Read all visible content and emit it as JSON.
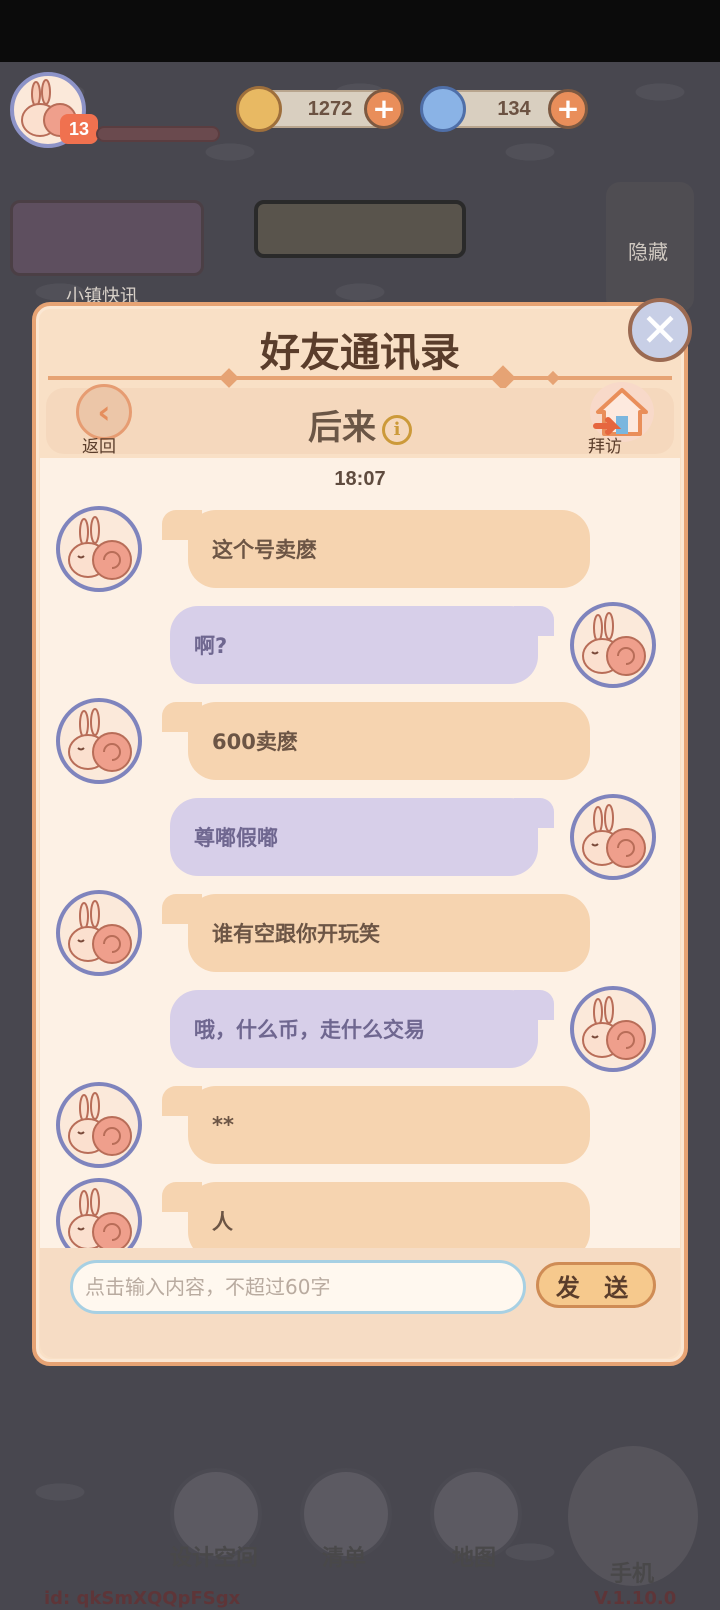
{
  "top_bar": {
    "level": "13",
    "coins": "1272",
    "gems": "134"
  },
  "background": {
    "news_label": "小镇快讯",
    "hide_label": "隐藏"
  },
  "dialog": {
    "title": "好友通讯录",
    "contact_name": "后来",
    "back_label": "返回",
    "visit_label": "拜访",
    "time": "18:07",
    "messages": [
      {
        "side": "left",
        "text": "这个号卖麽"
      },
      {
        "side": "right",
        "text": "啊?"
      },
      {
        "side": "left",
        "text": "600卖麽"
      },
      {
        "side": "right",
        "text": "尊嘟假嘟"
      },
      {
        "side": "left",
        "text": "谁有空跟你开玩笑"
      },
      {
        "side": "right",
        "text": "哦，什么币，走什么交易"
      },
      {
        "side": "left",
        "text": "**"
      },
      {
        "side": "left",
        "text": "人"
      }
    ],
    "input_placeholder": "点击输入内容，不超过60字",
    "send_label": "发 送"
  },
  "bottom_nav": {
    "design_label": "设计空间",
    "list_label": "清单",
    "map_label": "地图",
    "phone_label": "手机"
  },
  "footer": {
    "id": "id: qkSmXQQpFSgx",
    "version": "V.1.10.0"
  },
  "colors": {
    "dialog_bg": "#f9e0c6",
    "dialog_border": "#e6a374",
    "bubble_left": "#f6d4b0",
    "bubble_right": "#d7cfe9",
    "accent": "#e98e5a"
  }
}
